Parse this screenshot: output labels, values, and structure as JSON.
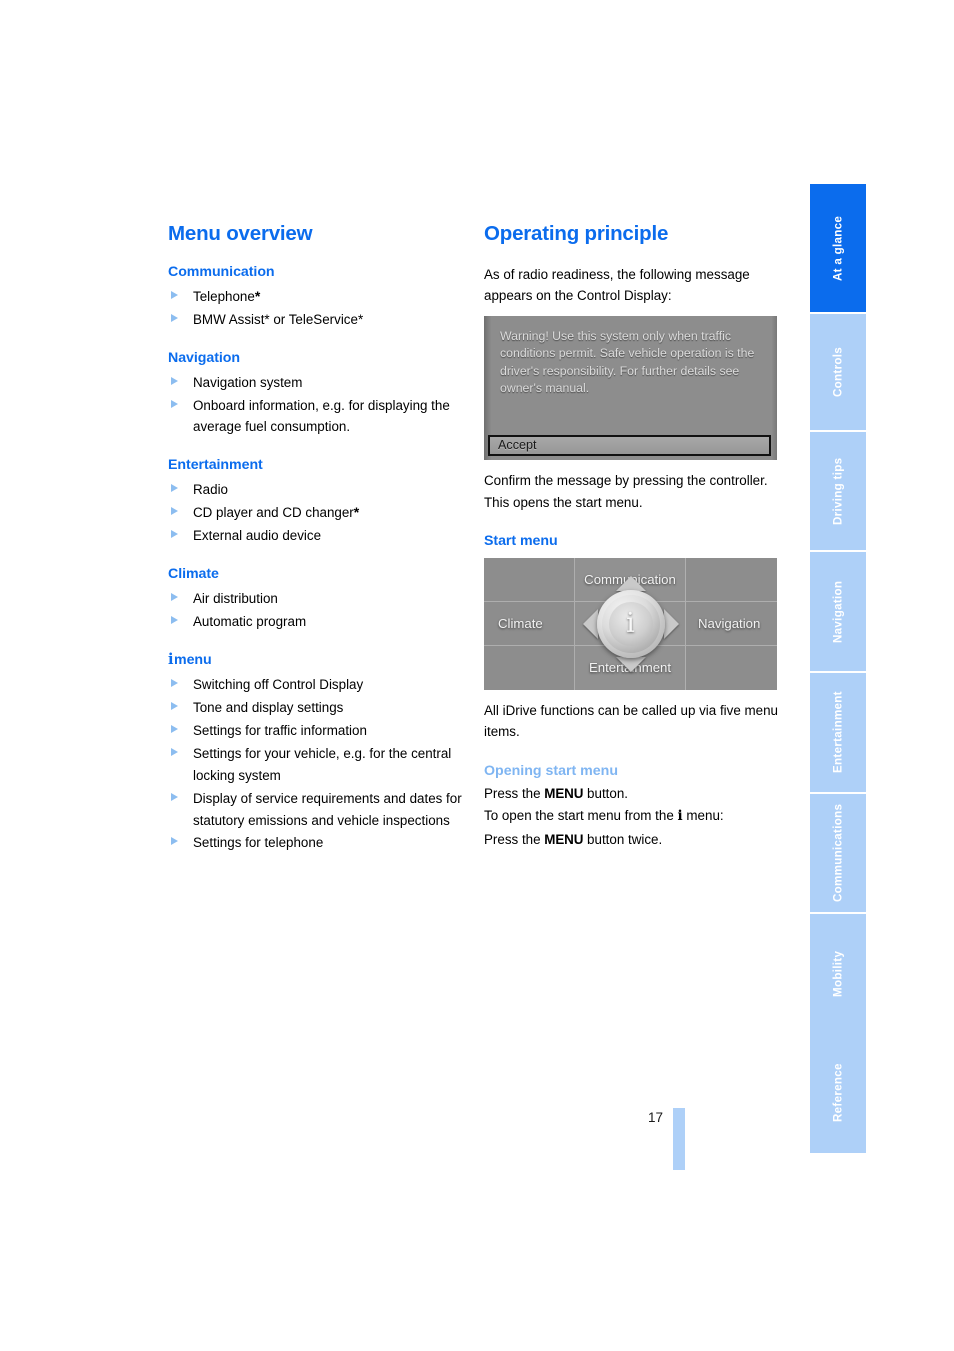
{
  "left_column": {
    "title": "Menu overview",
    "groups": [
      {
        "heading": "Communication",
        "items": [
          {
            "text": "Telephone",
            "asterisk": true
          },
          {
            "text": "BMW Assist* or TeleService*",
            "asterisk": false
          }
        ]
      },
      {
        "heading": "Navigation",
        "items": [
          {
            "text": "Navigation system",
            "asterisk": false
          },
          {
            "text": "Onboard information, e.g. for displaying the average fuel consumption.",
            "asterisk": false
          }
        ]
      },
      {
        "heading": "Entertainment",
        "items": [
          {
            "text": "Radio",
            "asterisk": false
          },
          {
            "text": "CD player and CD changer",
            "asterisk": true
          },
          {
            "text": "External audio device",
            "asterisk": false
          }
        ]
      },
      {
        "heading": "Climate",
        "items": [
          {
            "text": "Air distribution",
            "asterisk": false
          },
          {
            "text": "Automatic program",
            "asterisk": false
          }
        ]
      },
      {
        "heading_glyph": "i",
        "heading": "menu",
        "items": [
          {
            "text": "Switching off Control Display",
            "asterisk": false
          },
          {
            "text": "Tone and display settings",
            "asterisk": false
          },
          {
            "text": "Settings for traffic information",
            "asterisk": false
          },
          {
            "text": "Settings for your vehicle, e.g. for the central locking system",
            "asterisk": false
          },
          {
            "text": "Display of service requirements and dates for statutory emissions and vehicle inspections",
            "asterisk": false
          },
          {
            "text": "Settings for telephone",
            "asterisk": false
          }
        ]
      }
    ]
  },
  "right_column": {
    "title": "Operating principle",
    "intro": "As of radio readiness, the following message appears on the Control Display:",
    "warning_screen": {
      "message": "Warning! Use this system only when traffic conditions permit. Safe vehicle operation is the driver's responsibility. For further details see owner's manual.",
      "accept_label": "Accept"
    },
    "after_warning_line1": "Confirm the message by pressing the controller.",
    "after_warning_line2": "This opens the start menu.",
    "start_menu_heading": "Start menu",
    "start_menu_screen": {
      "top_label": "Communication",
      "left_label": "Climate",
      "right_label": "Navigation",
      "bottom_label": "Entertainment",
      "center_glyph": "i"
    },
    "start_menu_caption": "All iDrive functions can be called up via five menu items.",
    "opening_heading": "Opening start menu",
    "opening_line1_pre": "Press the ",
    "opening_line1_kw": "MENU",
    "opening_line1_post": " button.",
    "opening_line2_pre": "To open the start menu from the ",
    "opening_line2_glyph": "i",
    "opening_line2_post": " menu:",
    "opening_line3_pre": "Press the ",
    "opening_line3_kw": "MENU",
    "opening_line3_post": " button twice."
  },
  "tabs": [
    {
      "label": "At a glance",
      "active": true
    },
    {
      "label": "Controls",
      "active": false
    },
    {
      "label": "Driving tips",
      "active": false
    },
    {
      "label": "Navigation",
      "active": false
    },
    {
      "label": "Entertainment",
      "active": false
    },
    {
      "label": "Communications",
      "active": false
    },
    {
      "label": "Mobility",
      "active": false
    },
    {
      "label": "Reference",
      "active": false
    }
  ],
  "page_number": "17",
  "colors": {
    "heading_blue": "#0b6ced",
    "light_blue": "#7fb5f2",
    "tab_inactive": "#aed0f8"
  }
}
